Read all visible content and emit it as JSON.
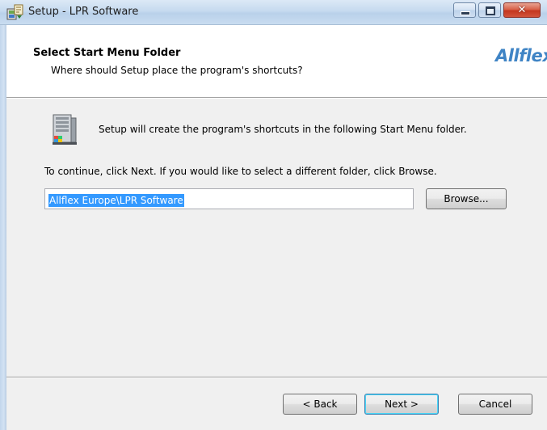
{
  "window": {
    "title": "Setup - LPR Software",
    "close_glyph": "✕"
  },
  "header": {
    "title": "Select Start Menu Folder",
    "subtitle": "Where should Setup place the program's shortcuts?",
    "logo_text": "Allflex",
    "logo_color": "#3f84c5"
  },
  "body": {
    "info_text": "Setup will create the program's shortcuts in the following Start Menu folder.",
    "continue_text": "To continue, click Next. If you would like to select a different folder, click Browse.",
    "folder_value": "Allflex Europe\\LPR Software",
    "browse_label": "Browse..."
  },
  "footer": {
    "back_label": "< Back",
    "next_label": "Next >",
    "cancel_label": "Cancel"
  },
  "icons": {
    "title_icon": "setup-installer-icon",
    "folder_icon": "start-menu-folder-icon"
  },
  "colors": {
    "selection": "#3399ff",
    "close_button": "#c4371f",
    "titlebar": "#c6daef"
  }
}
